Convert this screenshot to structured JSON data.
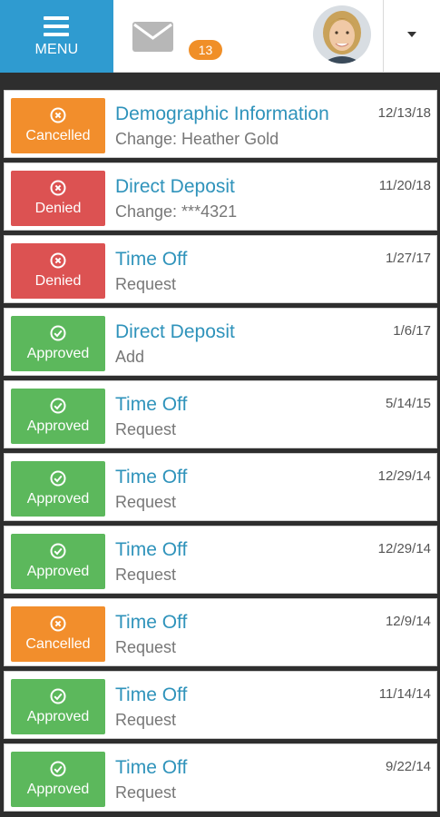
{
  "header": {
    "menu_label": "MENU",
    "message_count": "13",
    "colors": {
      "menu_bg": "#2f9bd0",
      "badge_bg": "#f08f28"
    }
  },
  "status_colors": {
    "Cancelled": "#f28e2c",
    "Denied": "#dc5252",
    "Approved": "#5cb85c"
  },
  "requests": [
    {
      "status": "Cancelled",
      "title": "Demographic Information",
      "subtitle": "Change: Heather Gold",
      "date": "12/13/18"
    },
    {
      "status": "Denied",
      "title": "Direct Deposit",
      "subtitle": "Change: ***4321",
      "date": "11/20/18"
    },
    {
      "status": "Denied",
      "title": "Time Off",
      "subtitle": "Request",
      "date": "1/27/17"
    },
    {
      "status": "Approved",
      "title": "Direct Deposit",
      "subtitle": "Add",
      "date": "1/6/17"
    },
    {
      "status": "Approved",
      "title": "Time Off",
      "subtitle": "Request",
      "date": "5/14/15"
    },
    {
      "status": "Approved",
      "title": "Time Off",
      "subtitle": "Request",
      "date": "12/29/14"
    },
    {
      "status": "Approved",
      "title": "Time Off",
      "subtitle": "Request",
      "date": "12/29/14"
    },
    {
      "status": "Cancelled",
      "title": "Time Off",
      "subtitle": "Request",
      "date": "12/9/14"
    },
    {
      "status": "Approved",
      "title": "Time Off",
      "subtitle": "Request",
      "date": "11/14/14"
    },
    {
      "status": "Approved",
      "title": "Time Off",
      "subtitle": "Request",
      "date": "9/22/14"
    }
  ]
}
